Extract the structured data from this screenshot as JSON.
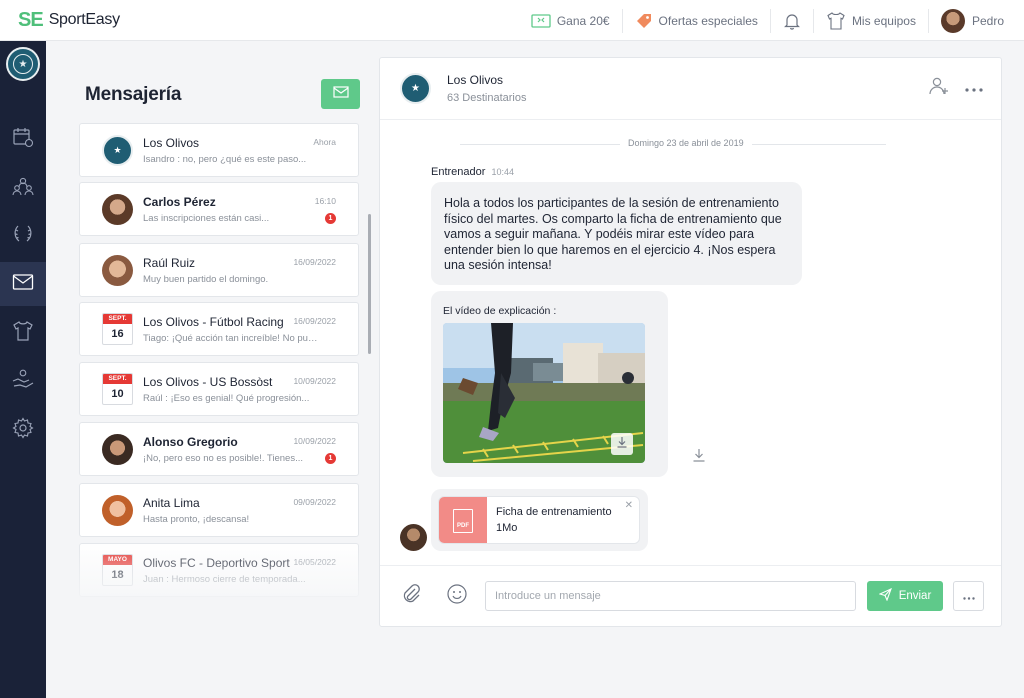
{
  "brand": {
    "mark": "SE",
    "name": "SportEasy"
  },
  "topnav": {
    "earn": "Gana 20€",
    "offers": "Ofertas especiales",
    "teams": "Mis equipos",
    "user": "Pedro"
  },
  "sidebar": {
    "items": [
      {
        "icon": "calendar-icon"
      },
      {
        "icon": "members-icon"
      },
      {
        "icon": "laurel-icon"
      },
      {
        "icon": "mail-icon",
        "active": true
      },
      {
        "icon": "shirt-icon"
      },
      {
        "icon": "handshake-icon"
      },
      {
        "icon": "gear-icon"
      }
    ]
  },
  "messages_panel": {
    "title": "Mensajería",
    "conversations": [
      {
        "name": "Los Olivos",
        "time": "Ahora",
        "preview": "Isandro : no, pero ¿qué es este paso...",
        "bold": false,
        "unread": null,
        "avatar": "club-badge"
      },
      {
        "name": "Carlos Pérez",
        "time": "16:10",
        "preview": "Las inscripciones están casi...",
        "bold": true,
        "unread": "1",
        "avatar": "photo"
      },
      {
        "name": "Raúl Ruiz",
        "time": "16/09/2022",
        "preview": "Muy buen partido el domingo.",
        "bold": false,
        "unread": null,
        "avatar": "photo"
      },
      {
        "name": "Los Olivos - Fútbol Racing",
        "time": "16/09/2022",
        "preview": "Tiago: ¡Qué acción tan increíble! No pue...",
        "bold": false,
        "unread": null,
        "avatar": "calendar",
        "cal_month": "SEPT.",
        "cal_day": "16"
      },
      {
        "name": "Los Olivos - US Bossòst",
        "time": "10/09/2022",
        "preview": "Raúl : ¡Eso es genial! Qué progresión...",
        "bold": false,
        "unread": null,
        "avatar": "calendar",
        "cal_month": "SEPT.",
        "cal_day": "10"
      },
      {
        "name": "Alonso Gregorio",
        "time": "10/09/2022",
        "preview": "¡No, pero eso no es posible!. Tienes...",
        "bold": true,
        "unread": "1",
        "avatar": "photo"
      },
      {
        "name": "Anita Lima",
        "time": "09/09/2022",
        "preview": "Hasta pronto, ¡descansa!",
        "bold": false,
        "unread": null,
        "avatar": "photo"
      },
      {
        "name": "Olivos FC - Deportivo Sport",
        "time": "16/05/2022",
        "preview": "Juan : Hermoso cierre de temporada...",
        "bold": false,
        "unread": null,
        "avatar": "calendar",
        "cal_month": "MAYO",
        "cal_day": "18"
      }
    ]
  },
  "chat": {
    "title": "Los Olivos",
    "subtitle": "63 Destinatarios",
    "date": "Domingo 23 de abril de 2019",
    "sender": "Entrenador",
    "sender_time": "10:44",
    "message": "Hola a todos los participantes de la sesión de entrenamiento físico del martes. Os comparto la ficha de entrenamiento que vamos a seguir mañana. Y podéis mirar este vídeo para entender bien lo que haremos en el ejercicio 4. ¡Nos espera una sesión intensa!",
    "video_label": "El vídeo de explicación :",
    "file_name": "Ficha de entrenamiento",
    "file_size": "1Mo",
    "file_type": "PDF",
    "input_placeholder": "Introduce un mensaje",
    "send_label": "Enviar"
  },
  "colors": {
    "accent": "#5fc98a",
    "sidebar": "#1a2238",
    "unread": "#e53935",
    "pdf": "#f28b87"
  }
}
